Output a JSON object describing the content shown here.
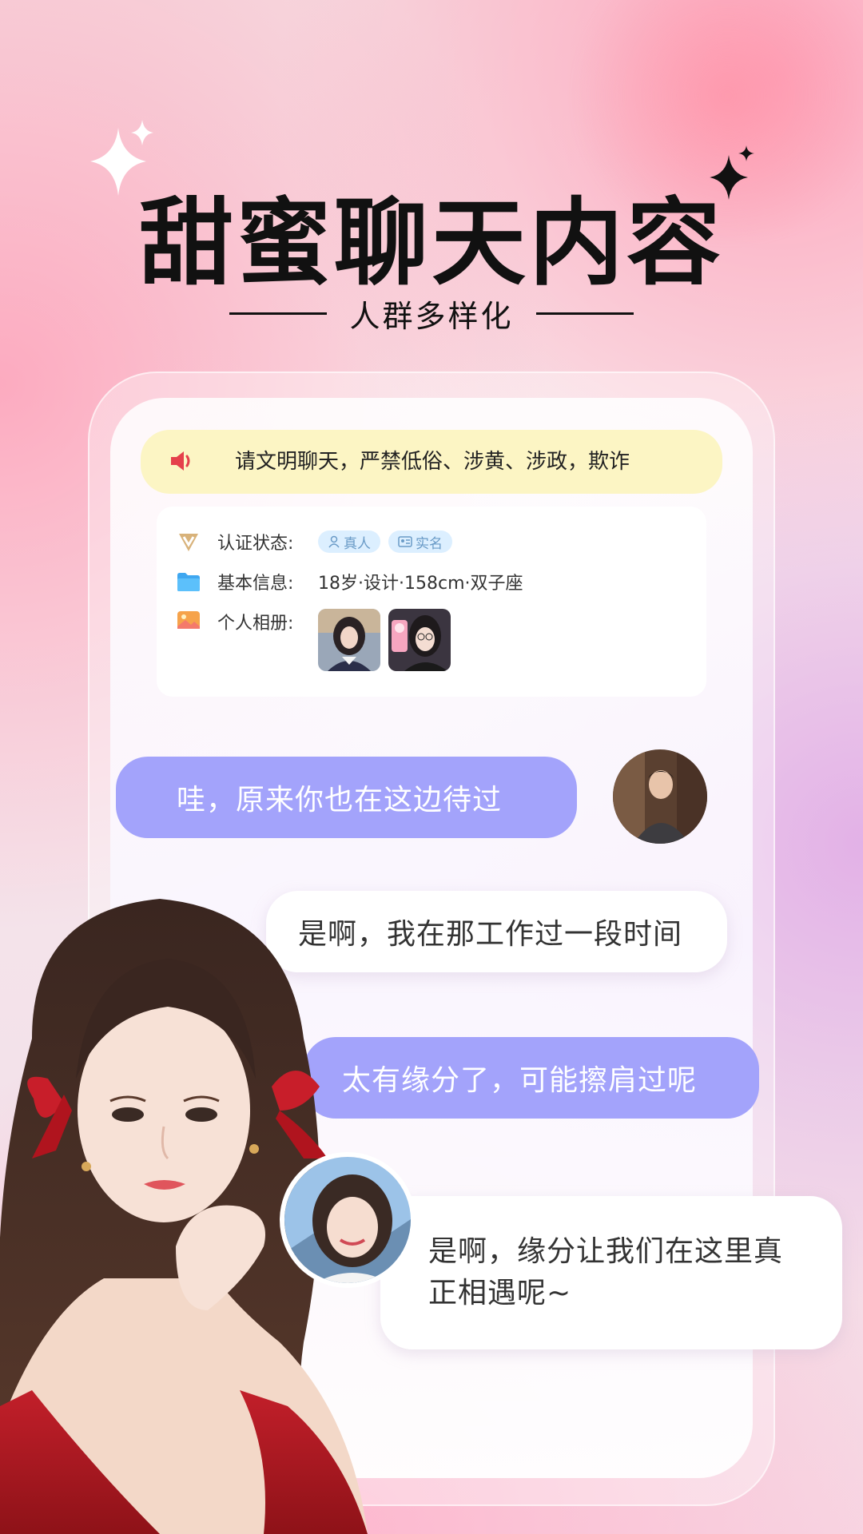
{
  "header": {
    "title": "甜蜜聊天内容",
    "subtitle": "人群多样化"
  },
  "notice": {
    "icon": "speaker-icon",
    "text": "请文明聊天，严禁低俗、涉黄、涉政，欺诈"
  },
  "profile": {
    "verification": {
      "label": "认证状态:",
      "tags": [
        "真人",
        "实名"
      ]
    },
    "basic_info": {
      "label": "基本信息:",
      "value": "18岁·设计·158cm·双子座"
    },
    "album": {
      "label": "个人相册:"
    }
  },
  "messages": [
    {
      "text": "哇，原来你也在这边待过"
    },
    {
      "text": "是啊，我在那工作过一段时间"
    },
    {
      "text": "太有缘分了，可能擦肩过呢"
    },
    {
      "text": "是啊，缘分让我们在这里真正相遇呢~"
    }
  ],
  "colors": {
    "purple_bubble": "#a3a3fb",
    "notice_bg": "#fcf5c4",
    "tag_bg": "#dcefff"
  }
}
